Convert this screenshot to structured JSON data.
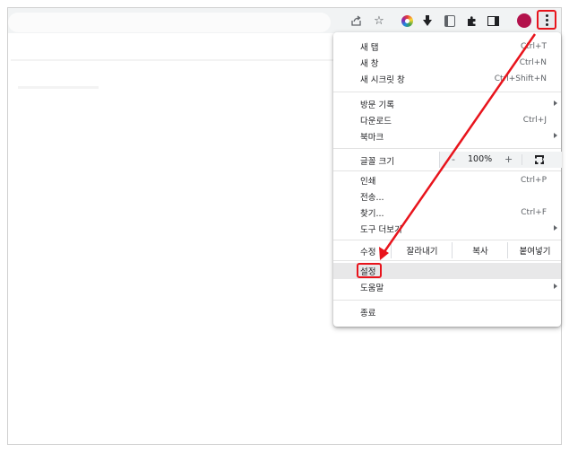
{
  "toolbar": {
    "icons": [
      "share-icon",
      "star-icon",
      "color-extension-icon",
      "download-extension-icon",
      "reader-extension-icon",
      "puzzle-icon",
      "side-panel-icon",
      "profile-avatar",
      "kebab-menu-icon"
    ],
    "avatar_color": "#b3124c",
    "highlight_color": "#e8141c"
  },
  "menu": {
    "new_tab": {
      "label": "새 탭",
      "shortcut": "Ctrl+T"
    },
    "new_window": {
      "label": "새 창",
      "shortcut": "Ctrl+N"
    },
    "incognito": {
      "label": "새 시크릿 창",
      "shortcut": "Ctrl+Shift+N"
    },
    "history": {
      "label": "방문 기록"
    },
    "downloads": {
      "label": "다운로드",
      "shortcut": "Ctrl+J"
    },
    "bookmarks": {
      "label": "북마크"
    },
    "zoom": {
      "label": "글꼴 크기",
      "minus": "-",
      "value": "100%",
      "plus": "+"
    },
    "print": {
      "label": "인쇄",
      "shortcut": "Ctrl+P"
    },
    "cast": {
      "label": "전송..."
    },
    "find": {
      "label": "찾기...",
      "shortcut": "Ctrl+F"
    },
    "more_tools": {
      "label": "도구 더보기"
    },
    "edit": {
      "label": "수정",
      "cut": "잘라내기",
      "copy": "복사",
      "paste": "붙여넣기"
    },
    "settings": {
      "label": "설정"
    },
    "help": {
      "label": "도움말"
    },
    "exit": {
      "label": "종료"
    }
  }
}
